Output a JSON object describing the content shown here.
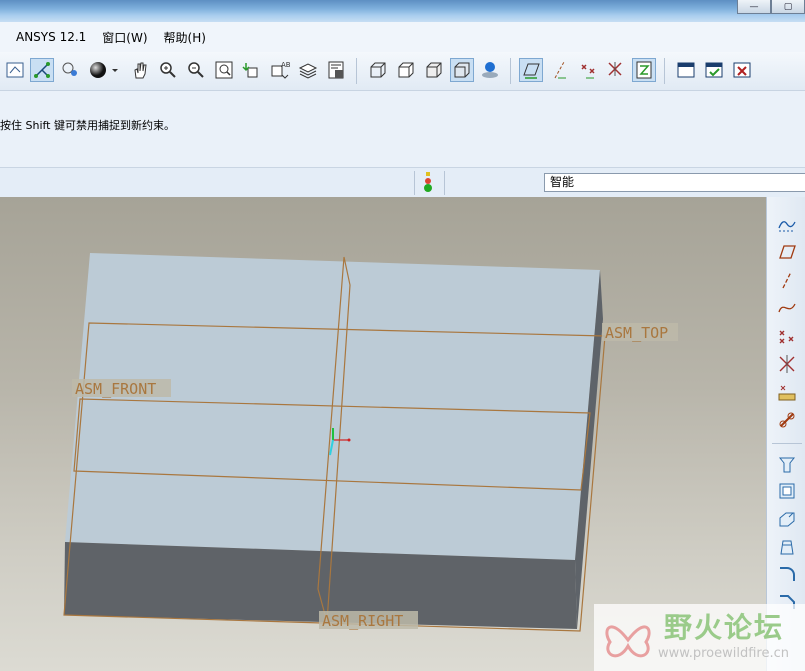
{
  "menubar": {
    "items": [
      "ANSYS 12.1",
      "窗口(W)",
      "帮助(H)"
    ]
  },
  "message": {
    "text": "按住 Shift 键可禁用捕捉到新约束。"
  },
  "filter": {
    "value": "智能"
  },
  "datums": {
    "top": "ASM_TOP",
    "front": "ASM_FRONT",
    "right": "ASM_RIGHT"
  },
  "watermark": {
    "title": "野火论坛",
    "url": "www.proewildfire.cn"
  },
  "window": {
    "minimize": "—",
    "restore": "▢"
  },
  "colors": {
    "datum": "#a9773f",
    "part_top": "#bccbd6",
    "part_side": "#5f6368",
    "accent": "#7ea8d1"
  }
}
